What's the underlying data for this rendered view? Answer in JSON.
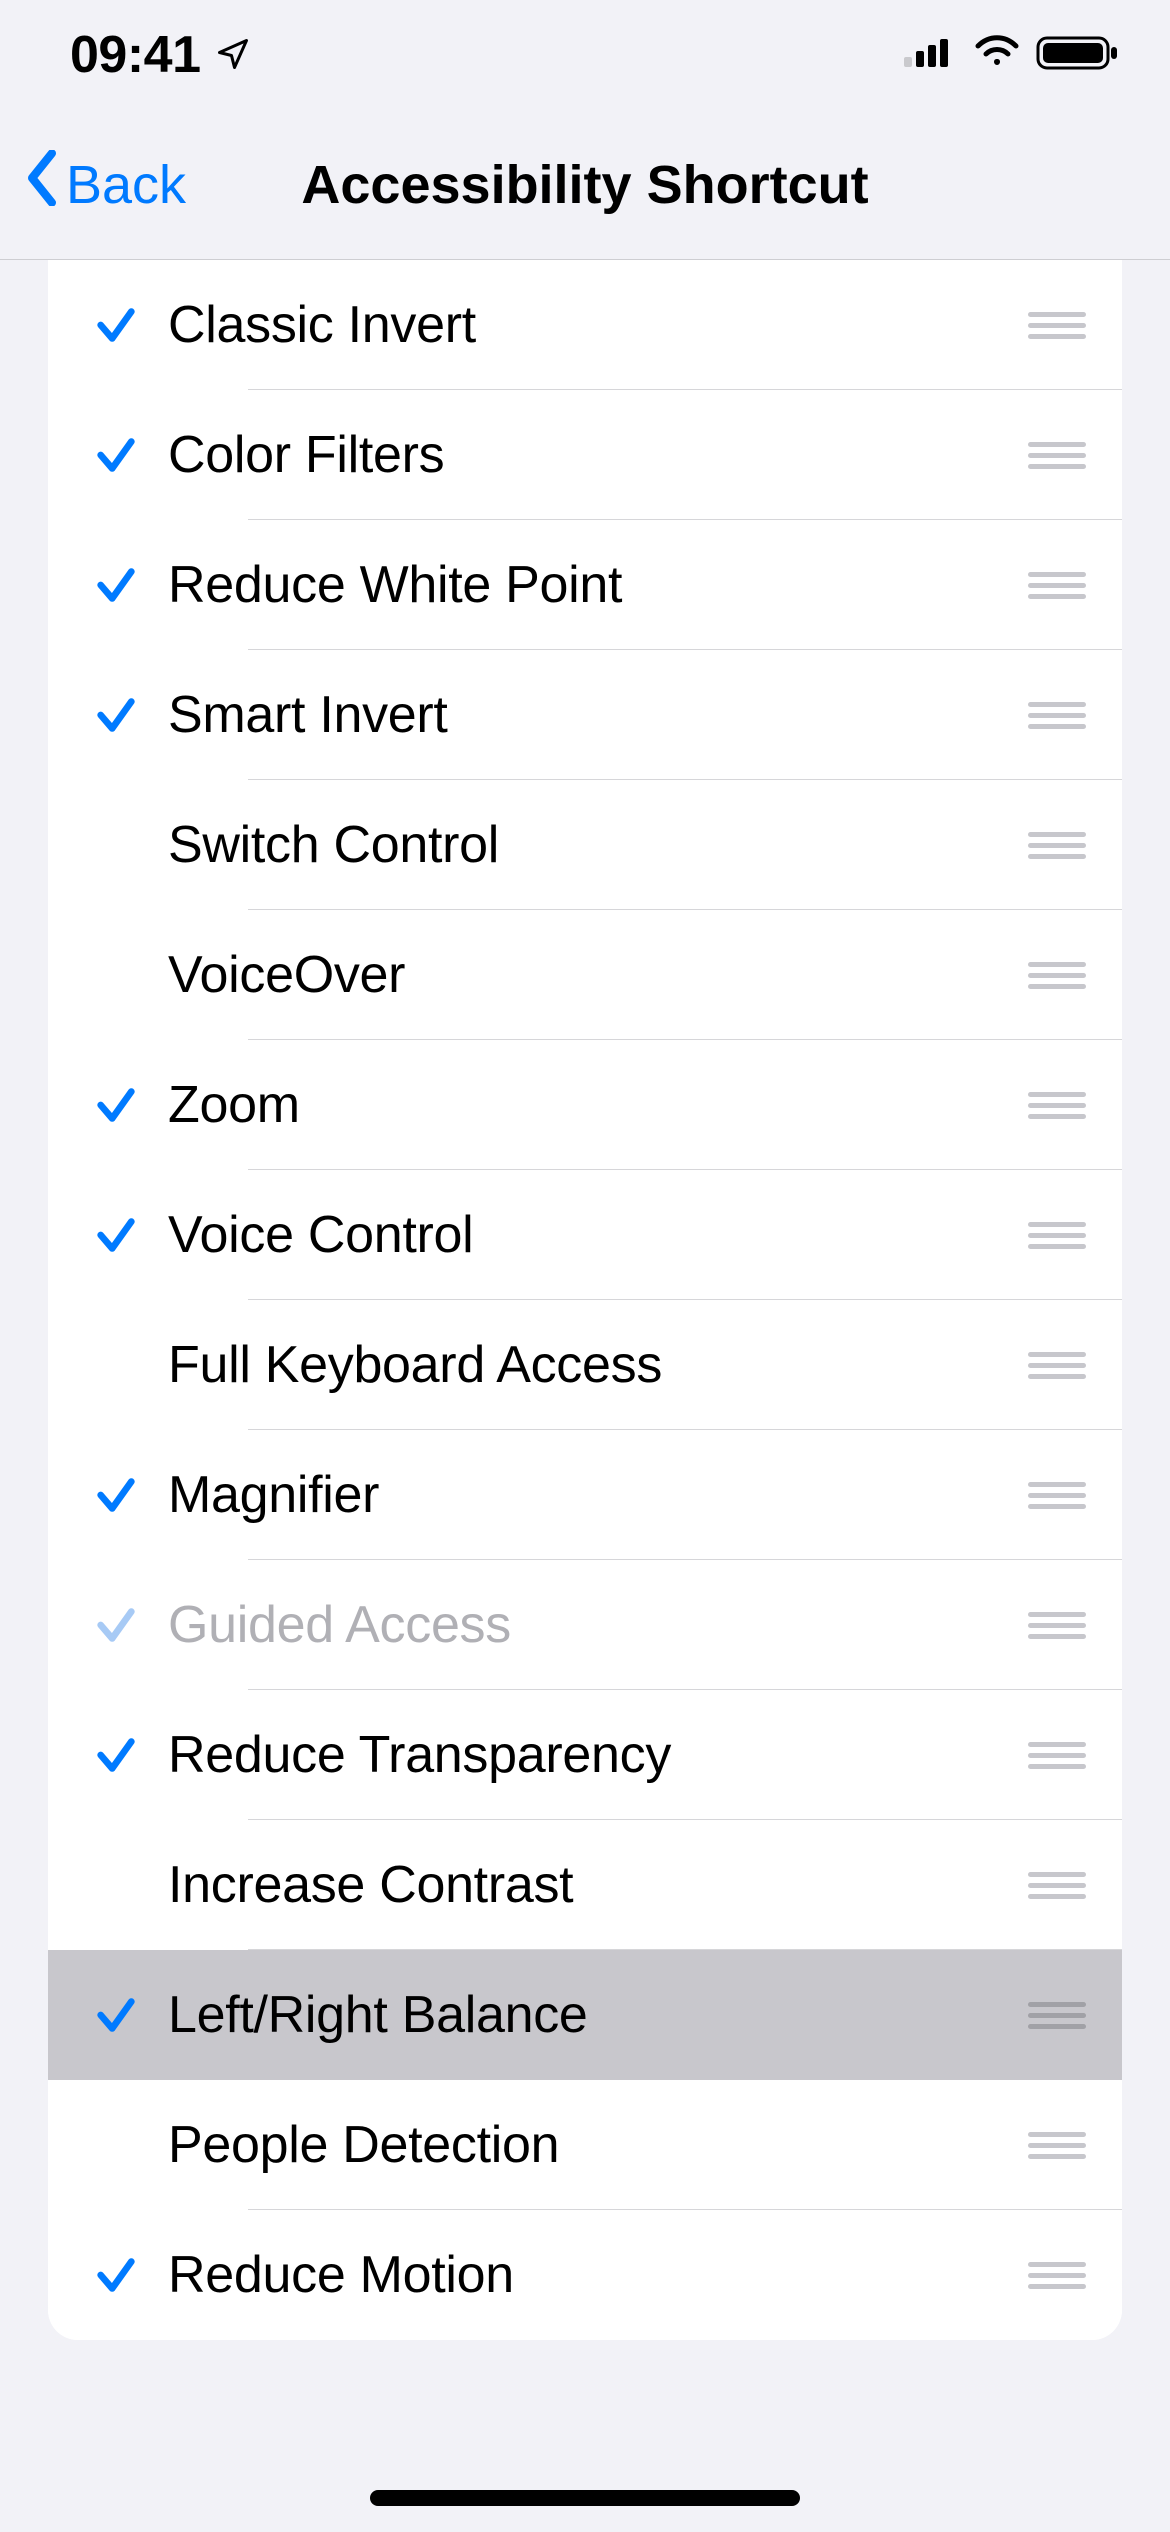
{
  "status": {
    "time": "09:41"
  },
  "nav": {
    "back_label": "Back",
    "title": "Accessibility Shortcut"
  },
  "items": [
    {
      "label": "Classic Invert",
      "checked": true,
      "disabled": false,
      "highlighted": false
    },
    {
      "label": "Color Filters",
      "checked": true,
      "disabled": false,
      "highlighted": false
    },
    {
      "label": "Reduce White Point",
      "checked": true,
      "disabled": false,
      "highlighted": false
    },
    {
      "label": "Smart Invert",
      "checked": true,
      "disabled": false,
      "highlighted": false
    },
    {
      "label": "Switch Control",
      "checked": false,
      "disabled": false,
      "highlighted": false
    },
    {
      "label": "VoiceOver",
      "checked": false,
      "disabled": false,
      "highlighted": false
    },
    {
      "label": "Zoom",
      "checked": true,
      "disabled": false,
      "highlighted": false
    },
    {
      "label": "Voice Control",
      "checked": true,
      "disabled": false,
      "highlighted": false
    },
    {
      "label": "Full Keyboard Access",
      "checked": false,
      "disabled": false,
      "highlighted": false
    },
    {
      "label": "Magnifier",
      "checked": true,
      "disabled": false,
      "highlighted": false
    },
    {
      "label": "Guided Access",
      "checked": true,
      "disabled": true,
      "highlighted": false
    },
    {
      "label": "Reduce Transparency",
      "checked": true,
      "disabled": false,
      "highlighted": false
    },
    {
      "label": "Increase Contrast",
      "checked": false,
      "disabled": false,
      "highlighted": false
    },
    {
      "label": "Left/Right Balance",
      "checked": true,
      "disabled": false,
      "highlighted": true
    },
    {
      "label": "People Detection",
      "checked": false,
      "disabled": false,
      "highlighted": false
    },
    {
      "label": "Reduce Motion",
      "checked": true,
      "disabled": false,
      "highlighted": false
    }
  ]
}
